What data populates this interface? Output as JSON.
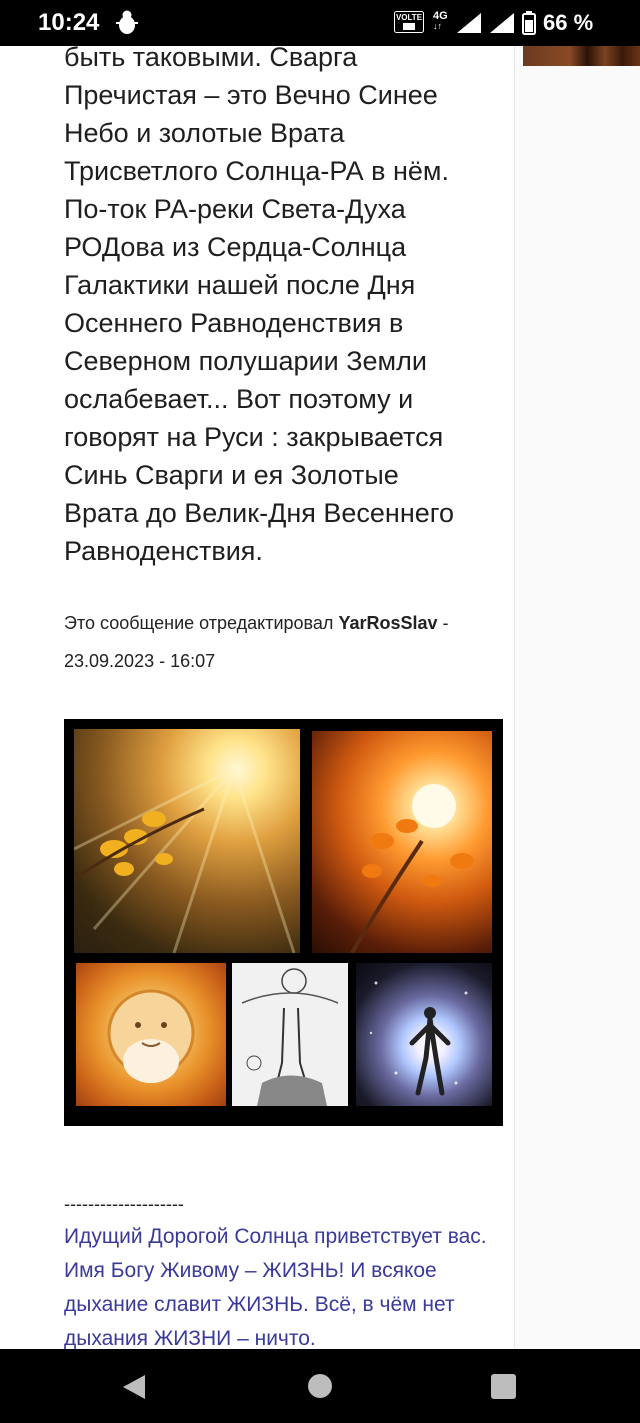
{
  "status_bar": {
    "time": "10:24",
    "network": "4G",
    "volte": "VOLTE",
    "battery": "66 %"
  },
  "post": {
    "lines": [
      "быть таковыми. Сварга",
      "Пречистая – это Вечно Синее",
      "Небо и золотые Врата",
      "Трисветлого Солнца-РА в нём.",
      "По-ток РА-реки Света-Духа",
      "РОДова из Сердца-Солнца",
      "Галактики нашей после Дня",
      "Осеннего Равноденствия в",
      "Северном полушарии Земли",
      "ослабевает... Вот поэтому и",
      "говорят на Руси : закрывается",
      "Синь Сварги и ея Золотые",
      "Врата до Велик-Дня Весеннего",
      "Равноденствия."
    ],
    "edit_prefix": "Это сообщение отредактировал",
    "edit_user": "YarRosSlav",
    "edit_sep": " -",
    "edit_datetime": "23.09.2023 - 16:07"
  },
  "signature": {
    "separator": "--------------------",
    "text": "Идущий Дорогой Солнца приветствует вас. Имя Богу Живому – ЖИЗНЬ! И всякое дыхание славит ЖИЗНЬ. Всё, в чём нет дыхания ЖИЗНИ – ничто."
  },
  "colors": {
    "signature": "#3a3a9a",
    "text": "#1f1f1f",
    "bars": "#000000"
  },
  "icons": [
    "bug-icon",
    "volte-icon",
    "signal-icon",
    "battery-icon",
    "back-icon",
    "home-icon",
    "recents-icon"
  ]
}
